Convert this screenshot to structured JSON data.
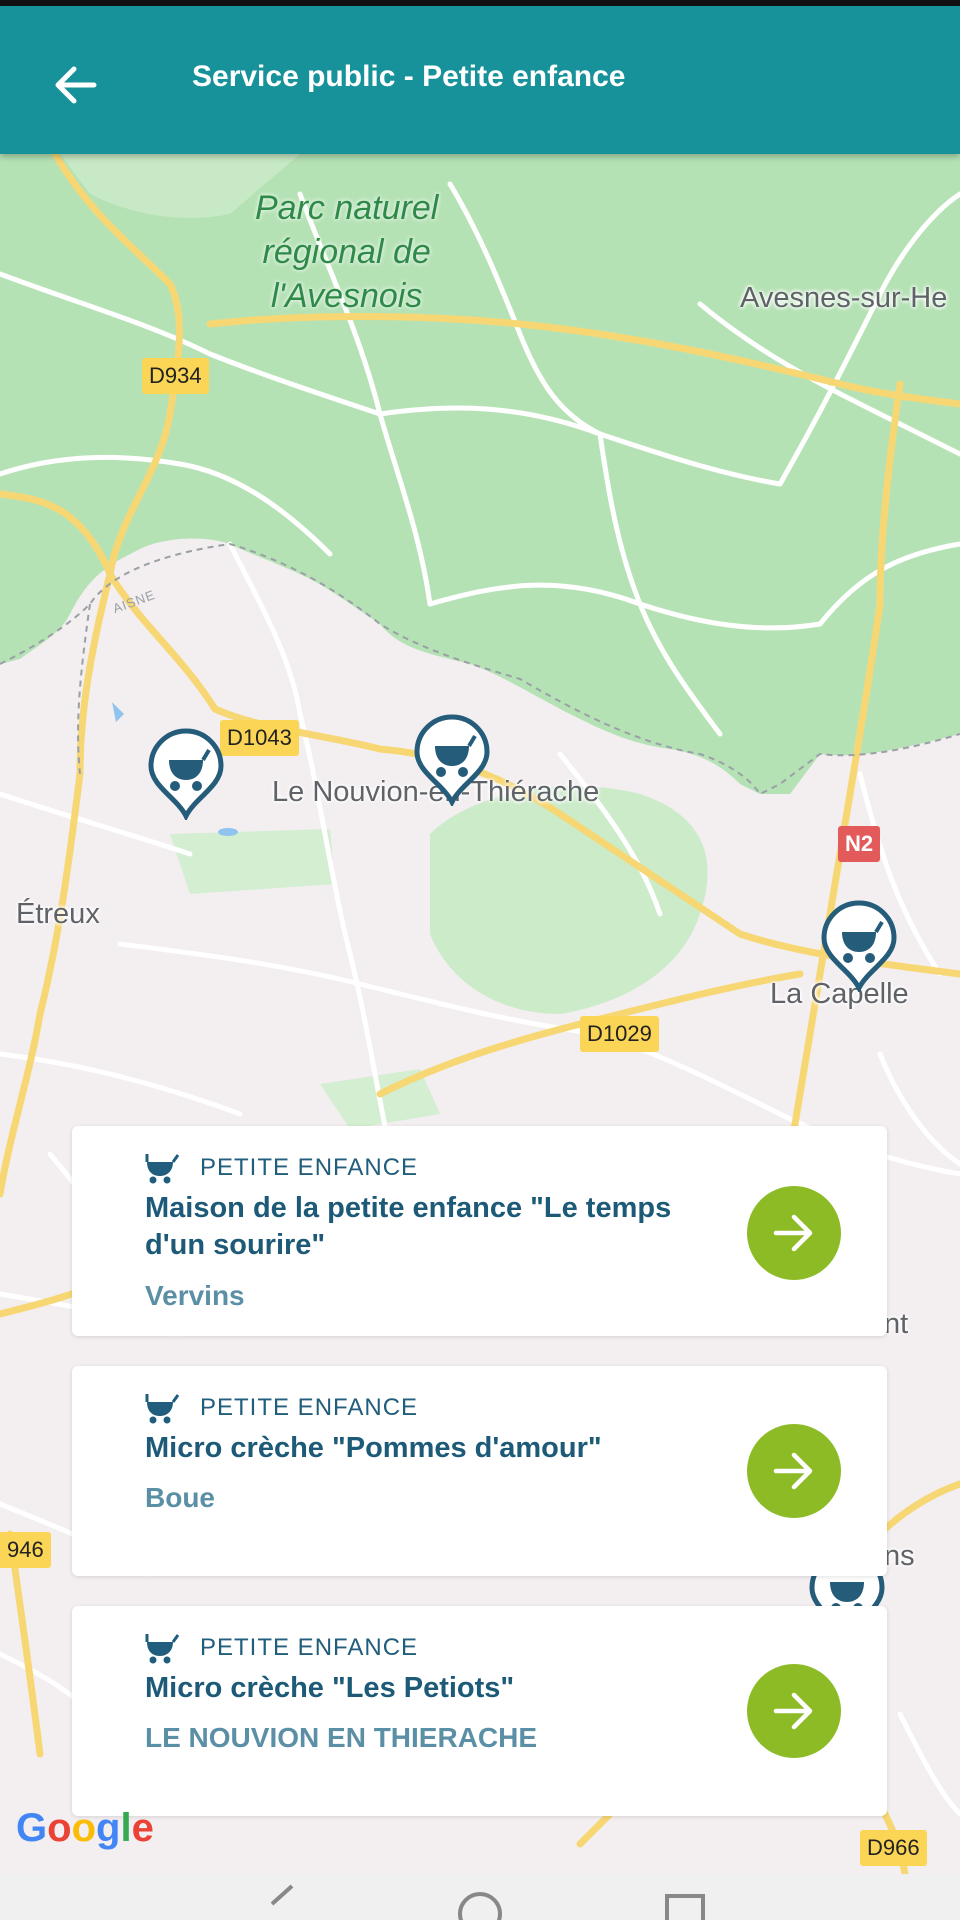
{
  "app_bar": {
    "title": "Service public - Petite enfance",
    "back_icon": "arrow-left-icon",
    "background": "#17929a"
  },
  "map": {
    "park_label": [
      "Parc naturel",
      "régional de",
      "l'Avesnois"
    ],
    "places": {
      "avesnes": "Avesnes-sur-He",
      "nouvion": "Le Nouvion-en-Thiérache",
      "etreux": "Étreux",
      "la_capelle": "La Capelle",
      "edge_nt": "nt",
      "edge_ns": "ns"
    },
    "region": "AISNE",
    "roads": {
      "d934": "D934",
      "d1043": "D1043",
      "d1029": "D1029",
      "n2": "N2",
      "d946": "946",
      "d966": "D966"
    },
    "marker_icon": "stroller-icon",
    "google": [
      "G",
      "o",
      "o",
      "g",
      "l",
      "e"
    ]
  },
  "cards": [
    {
      "category": "PETITE ENFANCE",
      "title": "Maison de la petite enfance \"Le temps d'un sourire\"",
      "city": "Vervins"
    },
    {
      "category": "PETITE ENFANCE",
      "title": "Micro crèche \"Pommes d'amour\"",
      "city": "Boue"
    },
    {
      "category": "PETITE ENFANCE",
      "title": "Micro crèche \"Les Petiots\"",
      "city": "LE NOUVION EN THIERACHE"
    }
  ],
  "colors": {
    "accent_green": "#8dbb25",
    "text_blue": "#1d5a78",
    "park_green": "#b5e2b5",
    "map_pink": "#f3eef0"
  }
}
